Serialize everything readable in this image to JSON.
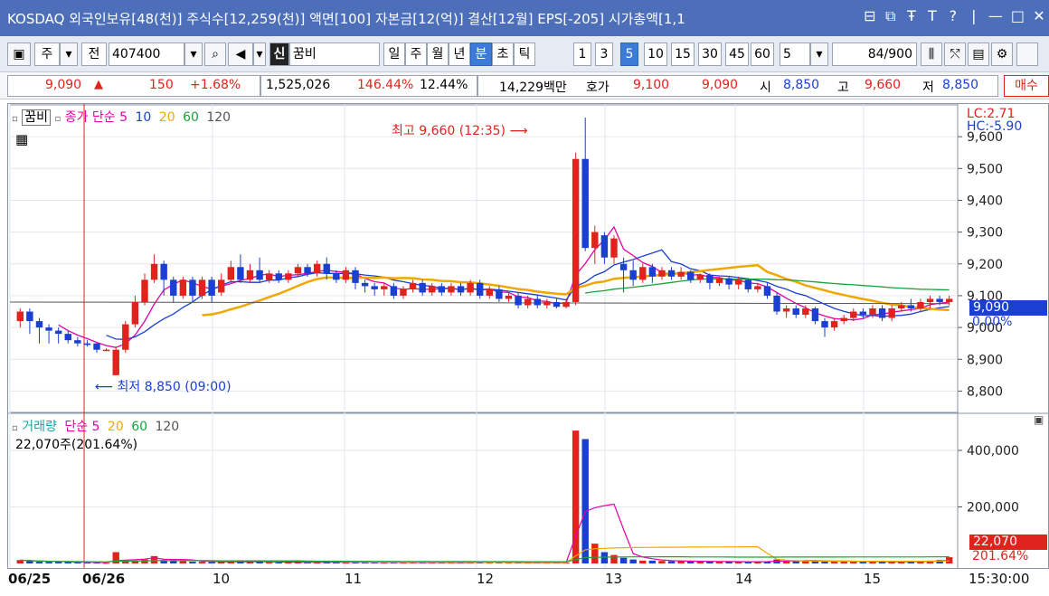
{
  "title": {
    "market": "KOSDAQ",
    "info": "외국인보유[48(천)] 주식수[12,259(천)] 액면[100] 자본금[12(억)] 결산[12월] EPS[-205] 시가총액[1,1",
    "controls": [
      "⊟",
      "⧉",
      "Ŧ",
      "T",
      "?",
      "|",
      "—",
      "□",
      "✕"
    ]
  },
  "toolbar": {
    "period_label": "주",
    "prefix_label": "전",
    "code": "407400",
    "credit_badge": "신",
    "stock_name": "꿈비",
    "periods": [
      "일",
      "주",
      "월",
      "년",
      "분",
      "초",
      "틱"
    ],
    "active_period": "분",
    "intervals": [
      "1",
      "3",
      "5",
      "10",
      "15",
      "30",
      "45",
      "60"
    ],
    "active_interval": "5",
    "interval_select": "5",
    "count": "84",
    "count_total": "/900"
  },
  "quote": {
    "price": "9,090",
    "change": "150",
    "change_pct": "+1.68%",
    "volume": "1,525,026",
    "volume_ratio": "146.44%",
    "turnover": "12.44%",
    "amount": "14,229백만",
    "ask_label": "호가",
    "ask": "9,100",
    "bid": "9,090",
    "open_label": "시",
    "open": "8,850",
    "high_label": "고",
    "high": "9,660",
    "low_label": "저",
    "low": "8,850",
    "buy_label": "매수"
  },
  "price_chart": {
    "stock_name": "꿈비",
    "legend_title": "종가 단순",
    "ma_labels": [
      "5",
      "10",
      "20",
      "60",
      "120"
    ],
    "ma_colors": [
      "#e600a8",
      "#1a3fd1",
      "#f0a800",
      "#1aa33a",
      "#555555"
    ],
    "lc": "LC:2.71",
    "hc": "HC:-5.90",
    "max_annotation": "최고 9,660 (12:35)",
    "min_annotation": "최저 8,850 (09:00)",
    "current_price": "9,090",
    "current_pct": "0.00%"
  },
  "volume_chart": {
    "legend_title": "거래량",
    "legend_ma": "단순",
    "ma_labels": [
      "5",
      "20",
      "60",
      "120"
    ],
    "ma_colors": [
      "#e600a8",
      "#f0a800",
      "#1aa33a",
      "#555555"
    ],
    "current_text": "22,070주(201.64%)",
    "current_volume": "22,070",
    "current_pct": "201.64%"
  },
  "x_axis": {
    "labels": [
      "06/25",
      "06/26",
      "10",
      "11",
      "12",
      "13",
      "14",
      "15",
      "15:30:00"
    ]
  },
  "chart_data": {
    "type": "candlestick",
    "y_ticks": [
      "9,600",
      "9,500",
      "9,400",
      "9,300",
      "9,200",
      "9,100",
      "9,000",
      "8,900",
      "8,800"
    ],
    "ylim": [
      8750,
      9680
    ],
    "volume_ticks": [
      "400,000",
      "200,000"
    ],
    "volume_ylim": [
      0,
      480000
    ],
    "candles": [
      {
        "o": 9020,
        "c": 9050,
        "h": 9060,
        "l": 9000,
        "v": 12000
      },
      {
        "o": 9050,
        "c": 9020,
        "h": 9060,
        "l": 8980,
        "v": 8000
      },
      {
        "o": 9020,
        "c": 9000,
        "h": 9030,
        "l": 8950,
        "v": 6000
      },
      {
        "o": 9000,
        "c": 8990,
        "h": 9010,
        "l": 8950,
        "v": 5000
      },
      {
        "o": 8990,
        "c": 8980,
        "h": 9000,
        "l": 8950,
        "v": 5000
      },
      {
        "o": 8980,
        "c": 8960,
        "h": 8990,
        "l": 8950,
        "v": 5000
      },
      {
        "o": 8960,
        "c": 8950,
        "h": 8970,
        "l": 8940,
        "v": 4000
      },
      {
        "o": 8950,
        "c": 8945,
        "h": 8960,
        "l": 8940,
        "v": 3000
      },
      {
        "o": 8950,
        "c": 8930,
        "h": 8950,
        "l": 8920,
        "v": 3000
      },
      {
        "o": 8930,
        "c": 8930,
        "h": 8935,
        "l": 8925,
        "v": 2000
      },
      {
        "o": 8850,
        "c": 8930,
        "h": 8940,
        "l": 8850,
        "v": 40000
      },
      {
        "o": 8930,
        "c": 9010,
        "h": 9020,
        "l": 8920,
        "v": 12000
      },
      {
        "o": 9010,
        "c": 9080,
        "h": 9100,
        "l": 9000,
        "v": 9000
      },
      {
        "o": 9080,
        "c": 9150,
        "h": 9170,
        "l": 9070,
        "v": 14000
      },
      {
        "o": 9150,
        "c": 9200,
        "h": 9230,
        "l": 9140,
        "v": 26000
      },
      {
        "o": 9200,
        "c": 9150,
        "h": 9210,
        "l": 9100,
        "v": 12000
      },
      {
        "o": 9150,
        "c": 9100,
        "h": 9160,
        "l": 9080,
        "v": 10000
      },
      {
        "o": 9100,
        "c": 9150,
        "h": 9160,
        "l": 9090,
        "v": 8000
      },
      {
        "o": 9150,
        "c": 9100,
        "h": 9160,
        "l": 9080,
        "v": 6000
      },
      {
        "o": 9100,
        "c": 9150,
        "h": 9160,
        "l": 9090,
        "v": 6000
      },
      {
        "o": 9150,
        "c": 9100,
        "h": 9160,
        "l": 9080,
        "v": 5000
      },
      {
        "o": 9110,
        "c": 9150,
        "h": 9170,
        "l": 9100,
        "v": 5000
      },
      {
        "o": 9150,
        "c": 9190,
        "h": 9210,
        "l": 9140,
        "v": 8000
      },
      {
        "o": 9190,
        "c": 9150,
        "h": 9230,
        "l": 9140,
        "v": 7000
      },
      {
        "o": 9150,
        "c": 9180,
        "h": 9200,
        "l": 9140,
        "v": 6000
      },
      {
        "o": 9180,
        "c": 9150,
        "h": 9220,
        "l": 9140,
        "v": 6000
      },
      {
        "o": 9150,
        "c": 9170,
        "h": 9180,
        "l": 9140,
        "v": 4000
      },
      {
        "o": 9170,
        "c": 9150,
        "h": 9180,
        "l": 9140,
        "v": 4000
      },
      {
        "o": 9150,
        "c": 9170,
        "h": 9180,
        "l": 9140,
        "v": 4000
      },
      {
        "o": 9170,
        "c": 9190,
        "h": 9200,
        "l": 9160,
        "v": 5000
      },
      {
        "o": 9190,
        "c": 9170,
        "h": 9200,
        "l": 9160,
        "v": 4000
      },
      {
        "o": 9170,
        "c": 9200,
        "h": 9210,
        "l": 9160,
        "v": 5000
      },
      {
        "o": 9200,
        "c": 9170,
        "h": 9220,
        "l": 9150,
        "v": 5000
      },
      {
        "o": 9170,
        "c": 9150,
        "h": 9180,
        "l": 9140,
        "v": 4000
      },
      {
        "o": 9150,
        "c": 9180,
        "h": 9190,
        "l": 9140,
        "v": 4000
      },
      {
        "o": 9180,
        "c": 9140,
        "h": 9190,
        "l": 9120,
        "v": 4000
      },
      {
        "o": 9140,
        "c": 9130,
        "h": 9150,
        "l": 9110,
        "v": 4000
      },
      {
        "o": 9130,
        "c": 9120,
        "h": 9140,
        "l": 9100,
        "v": 4000
      },
      {
        "o": 9120,
        "c": 9130,
        "h": 9140,
        "l": 9100,
        "v": 3000
      },
      {
        "o": 9130,
        "c": 9100,
        "h": 9140,
        "l": 9090,
        "v": 3000
      },
      {
        "o": 9100,
        "c": 9120,
        "h": 9130,
        "l": 9090,
        "v": 3000
      },
      {
        "o": 9120,
        "c": 9140,
        "h": 9150,
        "l": 9110,
        "v": 4000
      },
      {
        "o": 9140,
        "c": 9110,
        "h": 9150,
        "l": 9100,
        "v": 3000
      },
      {
        "o": 9110,
        "c": 9130,
        "h": 9140,
        "l": 9100,
        "v": 3000
      },
      {
        "o": 9130,
        "c": 9110,
        "h": 9140,
        "l": 9100,
        "v": 3000
      },
      {
        "o": 9110,
        "c": 9130,
        "h": 9140,
        "l": 9100,
        "v": 3000
      },
      {
        "o": 9130,
        "c": 9110,
        "h": 9140,
        "l": 9100,
        "v": 3000
      },
      {
        "o": 9110,
        "c": 9140,
        "h": 9150,
        "l": 9100,
        "v": 4000
      },
      {
        "o": 9140,
        "c": 9100,
        "h": 9150,
        "l": 9090,
        "v": 4000
      },
      {
        "o": 9100,
        "c": 9120,
        "h": 9130,
        "l": 9090,
        "v": 3000
      },
      {
        "o": 9120,
        "c": 9090,
        "h": 9130,
        "l": 9080,
        "v": 3000
      },
      {
        "o": 9090,
        "c": 9100,
        "h": 9110,
        "l": 9080,
        "v": 3000
      },
      {
        "o": 9100,
        "c": 9070,
        "h": 9110,
        "l": 9060,
        "v": 3000
      },
      {
        "o": 9070,
        "c": 9090,
        "h": 9100,
        "l": 9060,
        "v": 3000
      },
      {
        "o": 9090,
        "c": 9070,
        "h": 9100,
        "l": 9060,
        "v": 3000
      },
      {
        "o": 9070,
        "c": 9080,
        "h": 9090,
        "l": 9060,
        "v": 3000
      },
      {
        "o": 9080,
        "c": 9065,
        "h": 9090,
        "l": 9060,
        "v": 3000
      },
      {
        "o": 9065,
        "c": 9080,
        "h": 9090,
        "l": 9060,
        "v": 3000
      },
      {
        "o": 9080,
        "c": 9530,
        "h": 9550,
        "l": 9070,
        "v": 470000
      },
      {
        "o": 9530,
        "c": 9250,
        "h": 9660,
        "l": 9240,
        "v": 440000
      },
      {
        "o": 9250,
        "c": 9300,
        "h": 9320,
        "l": 9200,
        "v": 70000
      },
      {
        "o": 9290,
        "c": 9220,
        "h": 9300,
        "l": 9200,
        "v": 40000
      },
      {
        "o": 9220,
        "c": 9280,
        "h": 9290,
        "l": 9200,
        "v": 30000
      },
      {
        "o": 9200,
        "c": 9180,
        "h": 9220,
        "l": 9110,
        "v": 20000
      },
      {
        "o": 9180,
        "c": 9150,
        "h": 9210,
        "l": 9130,
        "v": 14000
      },
      {
        "o": 9150,
        "c": 9190,
        "h": 9200,
        "l": 9140,
        "v": 10000
      },
      {
        "o": 9190,
        "c": 9160,
        "h": 9200,
        "l": 9140,
        "v": 10000
      },
      {
        "o": 9160,
        "c": 9180,
        "h": 9190,
        "l": 9150,
        "v": 9000
      },
      {
        "o": 9180,
        "c": 9160,
        "h": 9190,
        "l": 9150,
        "v": 8000
      },
      {
        "o": 9160,
        "c": 9175,
        "h": 9190,
        "l": 9150,
        "v": 8000
      },
      {
        "o": 9175,
        "c": 9150,
        "h": 9180,
        "l": 9140,
        "v": 7000
      },
      {
        "o": 9150,
        "c": 9165,
        "h": 9170,
        "l": 9140,
        "v": 7000
      },
      {
        "o": 9165,
        "c": 9140,
        "h": 9170,
        "l": 9120,
        "v": 7000
      },
      {
        "o": 9140,
        "c": 9155,
        "h": 9160,
        "l": 9130,
        "v": 6000
      },
      {
        "o": 9155,
        "c": 9135,
        "h": 9160,
        "l": 9120,
        "v": 6000
      },
      {
        "o": 9135,
        "c": 9150,
        "h": 9160,
        "l": 9120,
        "v": 6000
      },
      {
        "o": 9150,
        "c": 9120,
        "h": 9155,
        "l": 9110,
        "v": 6000
      },
      {
        "o": 9120,
        "c": 9130,
        "h": 9140,
        "l": 9110,
        "v": 6000
      },
      {
        "o": 9130,
        "c": 9100,
        "h": 9140,
        "l": 9090,
        "v": 8000
      },
      {
        "o": 9100,
        "c": 9050,
        "h": 9110,
        "l": 9040,
        "v": 14000
      },
      {
        "o": 9050,
        "c": 9060,
        "h": 9070,
        "l": 9030,
        "v": 10000
      },
      {
        "o": 9060,
        "c": 9040,
        "h": 9070,
        "l": 9030,
        "v": 9000
      },
      {
        "o": 9040,
        "c": 9060,
        "h": 9070,
        "l": 9030,
        "v": 8000
      },
      {
        "o": 9060,
        "c": 9020,
        "h": 9065,
        "l": 9010,
        "v": 9000
      },
      {
        "o": 9020,
        "c": 9000,
        "h": 9030,
        "l": 8970,
        "v": 9000
      },
      {
        "o": 9000,
        "c": 9020,
        "h": 9030,
        "l": 8990,
        "v": 8000
      },
      {
        "o": 9020,
        "c": 9030,
        "h": 9040,
        "l": 9010,
        "v": 7000
      },
      {
        "o": 9030,
        "c": 9050,
        "h": 9060,
        "l": 9020,
        "v": 7000
      },
      {
        "o": 9050,
        "c": 9040,
        "h": 9060,
        "l": 9030,
        "v": 6000
      },
      {
        "o": 9040,
        "c": 9060,
        "h": 9070,
        "l": 9030,
        "v": 7000
      },
      {
        "o": 9060,
        "c": 9030,
        "h": 9070,
        "l": 9020,
        "v": 6000
      },
      {
        "o": 9030,
        "c": 9060,
        "h": 9070,
        "l": 9020,
        "v": 6000
      },
      {
        "o": 9060,
        "c": 9070,
        "h": 9080,
        "l": 9050,
        "v": 6000
      },
      {
        "o": 9070,
        "c": 9060,
        "h": 9090,
        "l": 9050,
        "v": 7000
      },
      {
        "o": 9060,
        "c": 9080,
        "h": 9090,
        "l": 9050,
        "v": 8000
      },
      {
        "o": 9080,
        "c": 9090,
        "h": 9100,
        "l": 9060,
        "v": 10000
      },
      {
        "o": 9090,
        "c": 9080,
        "h": 9100,
        "l": 9070,
        "v": 12000
      },
      {
        "o": 9080,
        "c": 9090,
        "h": 9100,
        "l": 9070,
        "v": 22070
      }
    ]
  }
}
